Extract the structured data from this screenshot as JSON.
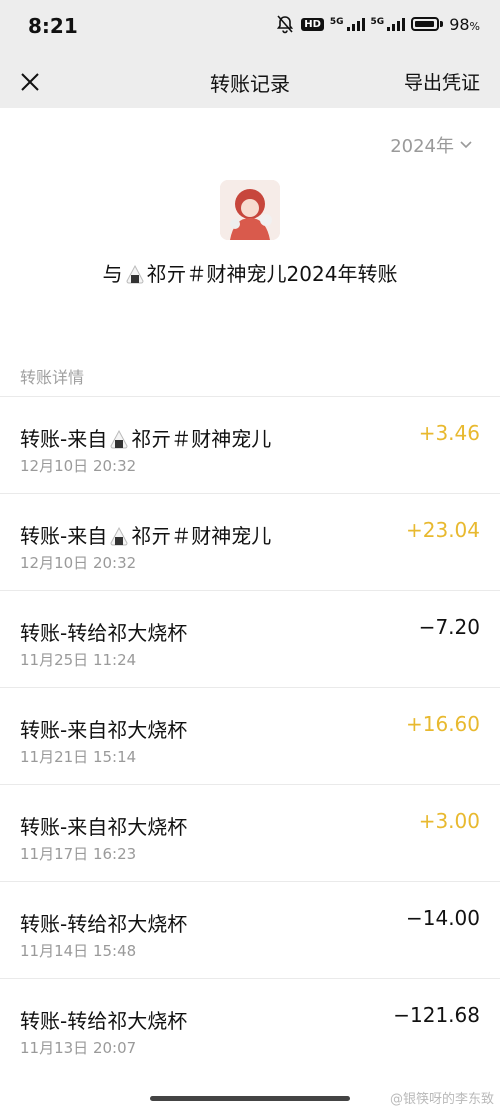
{
  "status_bar": {
    "time": "8:21",
    "hd_badge": "HD",
    "net1": "5G",
    "net2": "5G",
    "battery": "98",
    "battery_unit": "%"
  },
  "nav": {
    "title": "转账记录",
    "export_label": "导出凭证"
  },
  "filter": {
    "year": "2024年"
  },
  "header": {
    "prefix": "与",
    "name": "祁亓＃财神宠儿",
    "suffix": "2024年转账"
  },
  "section_label": "转账详情",
  "transactions": [
    {
      "title_prefix": "转账-来自",
      "title_name": "祁亓＃财神宠儿",
      "has_emoji": true,
      "date": "12月10日 20:32",
      "amount": "+3.46",
      "direction": "in"
    },
    {
      "title_prefix": "转账-来自",
      "title_name": "祁亓＃财神宠儿",
      "has_emoji": true,
      "date": "12月10日 20:32",
      "amount": "+23.04",
      "direction": "in"
    },
    {
      "title_prefix": "转账-转给祁大烧杯",
      "title_name": "",
      "has_emoji": false,
      "date": "11月25日 11:24",
      "amount": "−7.20",
      "direction": "out"
    },
    {
      "title_prefix": "转账-来自祁大烧杯",
      "title_name": "",
      "has_emoji": false,
      "date": "11月21日 15:14",
      "amount": "+16.60",
      "direction": "in"
    },
    {
      "title_prefix": "转账-来自祁大烧杯",
      "title_name": "",
      "has_emoji": false,
      "date": "11月17日 16:23",
      "amount": "+3.00",
      "direction": "in"
    },
    {
      "title_prefix": "转账-转给祁大烧杯",
      "title_name": "",
      "has_emoji": false,
      "date": "11月14日 15:48",
      "amount": "−14.00",
      "direction": "out"
    },
    {
      "title_prefix": "转账-转给祁大烧杯",
      "title_name": "",
      "has_emoji": false,
      "date": "11月13日 20:07",
      "amount": "−121.68",
      "direction": "out"
    }
  ],
  "watermark": "@银筷呀的李东致",
  "colors": {
    "income": "#e8b92f",
    "expense": "#111111",
    "bar_bg": "#ededed"
  }
}
